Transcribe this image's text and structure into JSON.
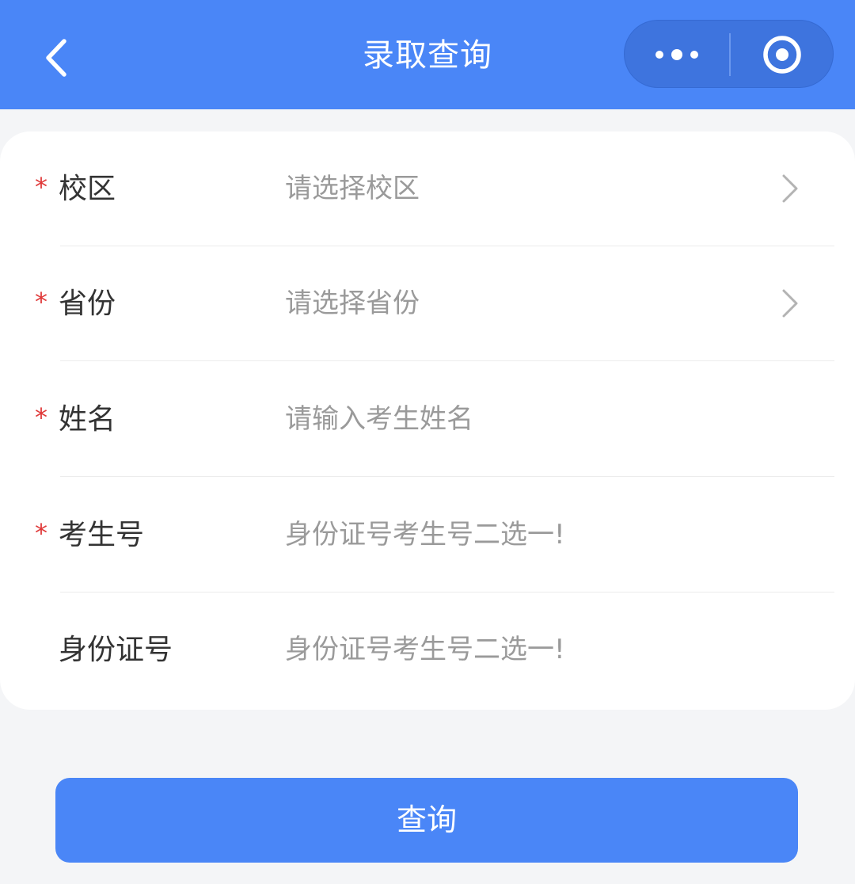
{
  "header": {
    "title": "录取查询",
    "back_icon": "chevron-left-icon",
    "more_icon": "more-dots-icon",
    "close_icon": "target-circle-icon"
  },
  "form": {
    "rows": [
      {
        "label": "校区",
        "required": true,
        "placeholder": "请选择校区",
        "type": "select"
      },
      {
        "label": "省份",
        "required": true,
        "placeholder": "请选择省份",
        "type": "select"
      },
      {
        "label": "姓名",
        "required": true,
        "placeholder": "请输入考生姓名",
        "type": "input"
      },
      {
        "label": "考生号",
        "required": true,
        "placeholder": "身份证号考生号二选一!",
        "type": "input"
      },
      {
        "label": "身份证号",
        "required": false,
        "placeholder": "身份证号考生号二选一!",
        "type": "input"
      }
    ],
    "required_mark": "*"
  },
  "submit": {
    "label": "查询"
  },
  "colors": {
    "primary": "#4a86f7",
    "capsule": "#3e74de",
    "required": "#e03a3a",
    "placeholder": "#9a9a9a",
    "label": "#333333"
  }
}
